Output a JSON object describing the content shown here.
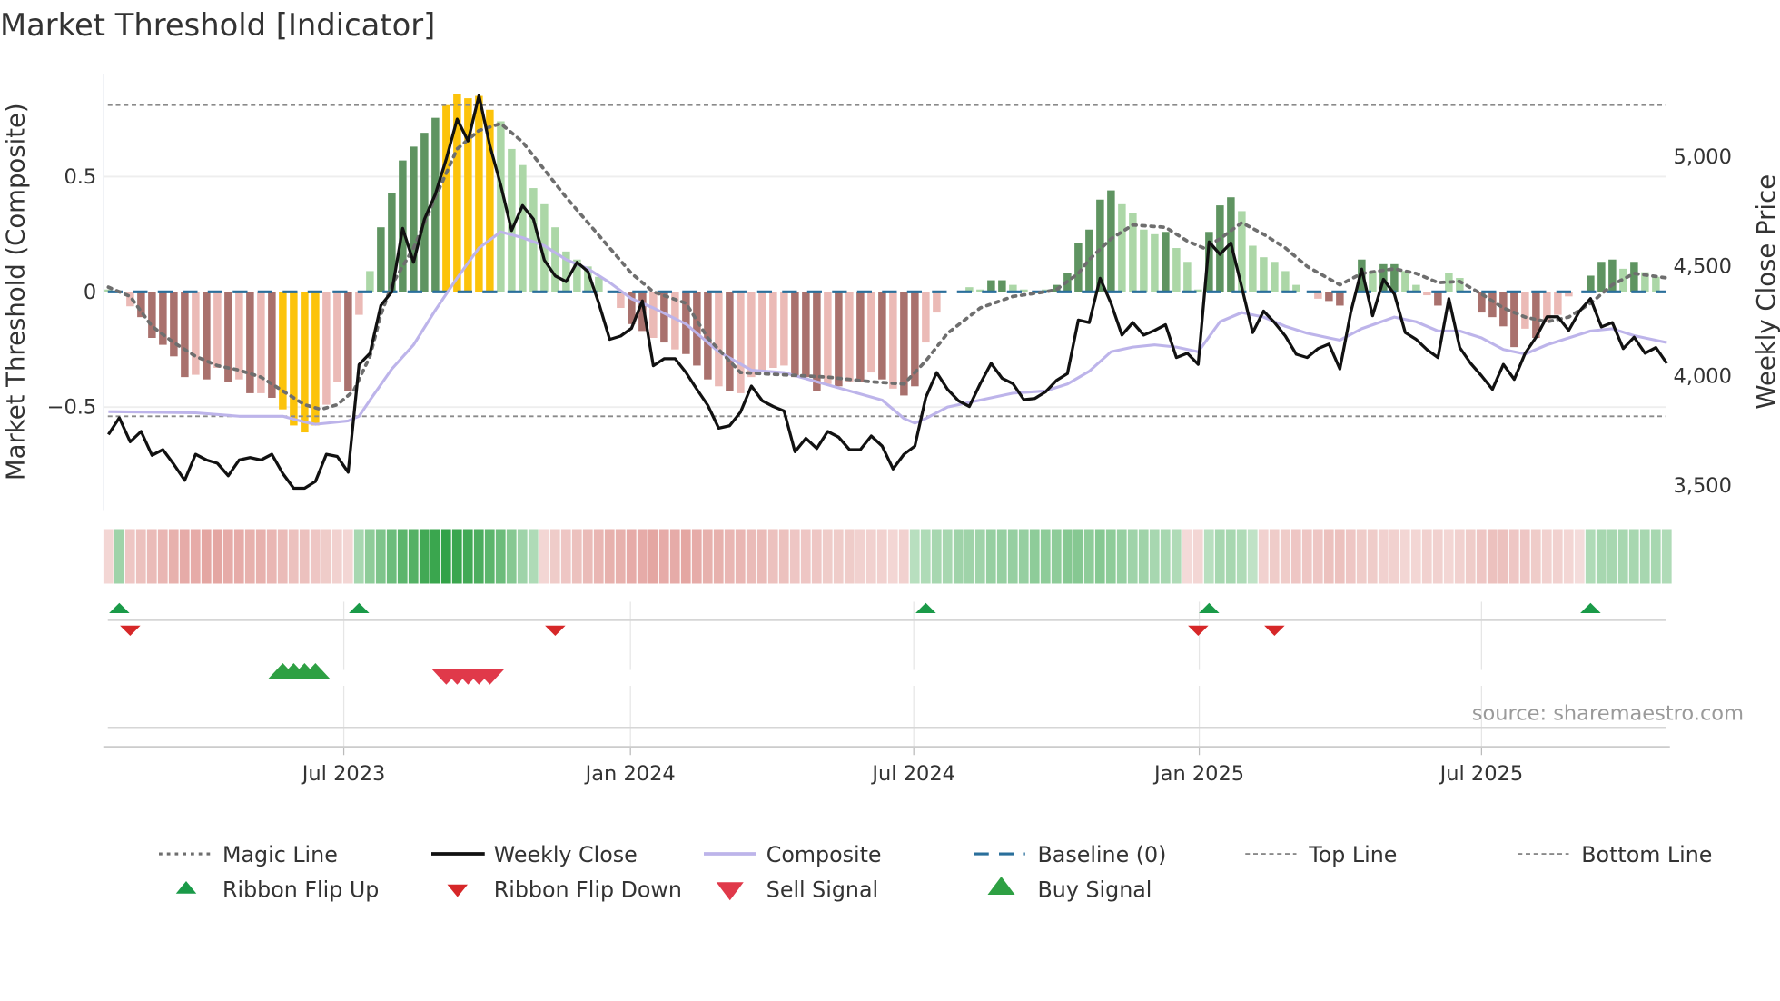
{
  "title": "Market Threshold [Indicator]",
  "source": "source: sharemaestro.com",
  "legend": {
    "magic_line": "Magic Line",
    "weekly_close": "Weekly Close",
    "composite": "Composite",
    "baseline": "Baseline (0)",
    "top_line": "Top Line",
    "bottom_line": "Bottom Line",
    "ribbon_flip_up": "Ribbon Flip Up",
    "ribbon_flip_down": "Ribbon Flip Down",
    "sell_signal": "Sell Signal",
    "buy_signal": "Buy Signal"
  },
  "colors": {
    "dark_red": "#a9716d",
    "light_red": "#ebbab6",
    "dark_green": "#5f9461",
    "light_green": "#acd7a7",
    "yellow": "#fcc30b",
    "close": "#111111",
    "composite": "#bdb4ea",
    "magic": "#6e6e6e",
    "baseline": "#2a6f9b",
    "levels": "#8a8a8a",
    "ribbon_green": "#2ea043",
    "ribbon_red": "#d67872",
    "buy": "#2ea043",
    "sell": "#e0394a",
    "flip_up": "#1a9a48",
    "flip_down": "#d62728"
  },
  "chart_data": {
    "type": "bar+line",
    "title": "Market Threshold [Indicator]",
    "ylabel_left": "Market Threshold (Composite)",
    "ylabel_right": "Weekly Close Price",
    "x_unit": "week index",
    "xlim": [
      0,
      143
    ],
    "ylim_left": [
      -0.95,
      0.93
    ],
    "ylim_right": [
      3450,
      5420
    ],
    "x_ticks": [
      {
        "week": 21.6,
        "label": "Jul 2023"
      },
      {
        "week": 47.9,
        "label": "Jan 2024"
      },
      {
        "week": 73.9,
        "label": "Jul 2024"
      },
      {
        "week": 100.1,
        "label": "Jan 2025"
      },
      {
        "week": 126.0,
        "label": "Jul 2025"
      }
    ],
    "left_ticks": [
      {
        "value": 0.5,
        "label": "0.5"
      },
      {
        "value": 0,
        "label": "0"
      },
      {
        "value": -0.5,
        "label": "−0.5"
      }
    ],
    "right_ticks": [
      {
        "value": 5000,
        "label": "5,000"
      },
      {
        "value": 4500,
        "label": "4,500"
      },
      {
        "value": 4000,
        "label": "4,000"
      },
      {
        "value": 3500,
        "label": "3,500"
      }
    ],
    "top_line": 0.81,
    "bottom_line": -0.54,
    "baseline": 0,
    "histogram": [
      0.01,
      0,
      -0.063,
      -0.11,
      -0.2,
      -0.23,
      -0.28,
      -0.37,
      -0.36,
      -0.38,
      -0.33,
      -0.39,
      -0.38,
      -0.44,
      -0.44,
      -0.46,
      -0.51,
      -0.58,
      -0.61,
      -0.58,
      -0.49,
      -0.39,
      -0.43,
      -0.1,
      0.09,
      0.28,
      0.43,
      0.57,
      0.63,
      0.69,
      0.755,
      0.81,
      0.86,
      0.84,
      0.85,
      0.79,
      0.74,
      0.62,
      0.55,
      0.45,
      0.38,
      0.28,
      0.175,
      0.14,
      0.11,
      0.065,
      0,
      -0.07,
      -0.14,
      -0.17,
      -0.2,
      -0.22,
      -0.25,
      -0.27,
      -0.32,
      -0.38,
      -0.41,
      -0.43,
      -0.44,
      -0.37,
      -0.35,
      -0.33,
      -0.32,
      -0.37,
      -0.37,
      -0.43,
      -0.4,
      -0.41,
      -0.39,
      -0.39,
      -0.35,
      -0.38,
      -0.42,
      -0.45,
      -0.41,
      -0.22,
      -0.09,
      0,
      0,
      0.02,
      0.01,
      0.05,
      0.05,
      0.03,
      0.01,
      0,
      0.01,
      0.03,
      0.08,
      0.21,
      0.27,
      0.4,
      0.44,
      0.38,
      0.34,
      0.27,
      0.25,
      0.26,
      0.19,
      0.13,
      0.01,
      0.26,
      0.375,
      0.41,
      0.35,
      0.2,
      0.15,
      0.13,
      0.09,
      0.03,
      0,
      -0.03,
      -0.04,
      -0.06,
      0,
      0.14,
      0.09,
      0.12,
      0.12,
      0.09,
      0.03,
      -0.015,
      -0.06,
      0.08,
      0.06,
      0,
      -0.09,
      -0.11,
      -0.15,
      -0.24,
      -0.16,
      -0.2,
      -0.13,
      -0.1,
      -0.02,
      0,
      0.07,
      0.13,
      0.14,
      0.1,
      0.13,
      0.085,
      0.065,
      0
    ],
    "histogram_style": [
      "LLLDDDDDLD",
      "LDLDLDYYYY",
      "LLDLLDDDDD",
      "DYYYYYLLLL",
      "LLLLLLLLDD",
      "LDLDDDLDLL",
      "LLLDDDLDLD",
      "LDLDDLLLLL",
      "LDDLLLLDDD",
      "DDDLLLLDLL",
      "LDDDLLLLLL",
      "LLDDLDLDDL",
      "LLDLLLDDDD",
      "LDLLLLDDDL",
      "DLLL"
    ],
    "weekly_close": [
      3727,
      3803,
      3694,
      3741,
      3632,
      3658,
      3591,
      3518,
      3637,
      3611,
      3596,
      3539,
      3611,
      3622,
      3611,
      3637,
      3549,
      3482,
      3482,
      3513,
      3637,
      3627,
      3555,
      4046,
      4098,
      4316,
      4378,
      4668,
      4513,
      4710,
      4824,
      4984,
      5166,
      5067,
      5274,
      5046,
      4865,
      4658,
      4772,
      4710,
      4523,
      4451,
      4425,
      4513,
      4471,
      4326,
      4161,
      4176,
      4212,
      4337,
      4041,
      4073,
      4073,
      4010,
      3933,
      3860,
      3756,
      3767,
      3829,
      3948,
      3881,
      3855,
      3834,
      3648,
      3710,
      3663,
      3741,
      3715,
      3658,
      3658,
      3720,
      3674,
      3570,
      3637,
      3674,
      3896,
      4010,
      3933,
      3881,
      3855,
      3959,
      4052,
      3984,
      3959,
      3886,
      3891,
      3922,
      3974,
      4005,
      4249,
      4238,
      4440,
      4326,
      4181,
      4238,
      4181,
      4202,
      4228,
      4078,
      4098,
      4047,
      4606,
      4549,
      4601,
      4399,
      4192,
      4290,
      4238,
      4176,
      4093,
      4078,
      4119,
      4140,
      4026,
      4285,
      4482,
      4269,
      4435,
      4368,
      4192,
      4161,
      4114,
      4078,
      4347,
      4124,
      4052,
      3995,
      3933,
      4047,
      3979,
      4098,
      4171,
      4264,
      4264,
      4202,
      4290,
      4347,
      4218,
      4238,
      4119,
      4171,
      4098,
      4124,
      4052
    ],
    "composite": [
      [
        0,
        -0.52
      ],
      [
        8,
        -0.525
      ],
      [
        12,
        -0.54
      ],
      [
        16,
        -0.54
      ],
      [
        18,
        -0.565
      ],
      [
        19,
        -0.575
      ],
      [
        22,
        -0.56
      ],
      [
        23,
        -0.54
      ],
      [
        24,
        -0.47
      ],
      [
        26,
        -0.335
      ],
      [
        28,
        -0.23
      ],
      [
        30,
        -0.08
      ],
      [
        32,
        0.06
      ],
      [
        34,
        0.19
      ],
      [
        36,
        0.26
      ],
      [
        38,
        0.235
      ],
      [
        40,
        0.2
      ],
      [
        42,
        0.14
      ],
      [
        44,
        0.1
      ],
      [
        46,
        0.04
      ],
      [
        48,
        -0.03
      ],
      [
        50,
        -0.07
      ],
      [
        53,
        -0.14
      ],
      [
        56,
        -0.26
      ],
      [
        59,
        -0.34
      ],
      [
        62,
        -0.35
      ],
      [
        65,
        -0.39
      ],
      [
        68,
        -0.43
      ],
      [
        71,
        -0.47
      ],
      [
        73,
        -0.55
      ],
      [
        74,
        -0.57
      ],
      [
        75,
        -0.55
      ],
      [
        77,
        -0.5
      ],
      [
        80,
        -0.47
      ],
      [
        83,
        -0.44
      ],
      [
        86,
        -0.43
      ],
      [
        88,
        -0.4
      ],
      [
        90,
        -0.345
      ],
      [
        92,
        -0.26
      ],
      [
        94,
        -0.24
      ],
      [
        96,
        -0.23
      ],
      [
        98,
        -0.24
      ],
      [
        100,
        -0.26
      ],
      [
        102,
        -0.13
      ],
      [
        104,
        -0.09
      ],
      [
        106,
        -0.11
      ],
      [
        108,
        -0.15
      ],
      [
        110,
        -0.18
      ],
      [
        112,
        -0.2
      ],
      [
        113,
        -0.21
      ],
      [
        115,
        -0.16
      ],
      [
        118,
        -0.11
      ],
      [
        120,
        -0.13
      ],
      [
        122,
        -0.17
      ],
      [
        124,
        -0.17
      ],
      [
        126,
        -0.2
      ],
      [
        128,
        -0.25
      ],
      [
        130,
        -0.27
      ],
      [
        132,
        -0.23
      ],
      [
        134,
        -0.2
      ],
      [
        136,
        -0.17
      ],
      [
        138,
        -0.16
      ],
      [
        140,
        -0.19
      ],
      [
        143,
        -0.22
      ]
    ],
    "magic_line": [
      [
        0,
        0.02
      ],
      [
        2,
        -0.02
      ],
      [
        4,
        -0.15
      ],
      [
        6,
        -0.22
      ],
      [
        8,
        -0.28
      ],
      [
        10,
        -0.32
      ],
      [
        12,
        -0.34
      ],
      [
        14,
        -0.37
      ],
      [
        16,
        -0.43
      ],
      [
        18,
        -0.49
      ],
      [
        19.5,
        -0.51
      ],
      [
        21,
        -0.49
      ],
      [
        22.5,
        -0.43
      ],
      [
        24,
        -0.28
      ],
      [
        25,
        -0.1
      ],
      [
        26,
        0.03
      ],
      [
        28,
        0.19
      ],
      [
        30,
        0.41
      ],
      [
        32,
        0.62
      ],
      [
        34,
        0.7
      ],
      [
        36,
        0.73
      ],
      [
        38,
        0.65
      ],
      [
        40,
        0.53
      ],
      [
        42,
        0.41
      ],
      [
        44,
        0.3
      ],
      [
        46,
        0.19
      ],
      [
        48,
        0.08
      ],
      [
        50,
        0
      ],
      [
        53,
        -0.05
      ],
      [
        55,
        -0.2
      ],
      [
        58,
        -0.35
      ],
      [
        62,
        -0.36
      ],
      [
        66,
        -0.37
      ],
      [
        70,
        -0.39
      ],
      [
        73,
        -0.4
      ],
      [
        75,
        -0.3
      ],
      [
        77,
        -0.18
      ],
      [
        80,
        -0.07
      ],
      [
        83,
        -0.02
      ],
      [
        86,
        0
      ],
      [
        87,
        0.01
      ],
      [
        89,
        0.08
      ],
      [
        90,
        0.14
      ],
      [
        92,
        0.23
      ],
      [
        94,
        0.29
      ],
      [
        97,
        0.28
      ],
      [
        99,
        0.22
      ],
      [
        100.5,
        0.19
      ],
      [
        102,
        0.23
      ],
      [
        104,
        0.3
      ],
      [
        106,
        0.25
      ],
      [
        108,
        0.19
      ],
      [
        110,
        0.11
      ],
      [
        113,
        0.03
      ],
      [
        115,
        0.08
      ],
      [
        118,
        0.1
      ],
      [
        120,
        0.08
      ],
      [
        122,
        0.04
      ],
      [
        124,
        0.045
      ],
      [
        126,
        -0.01
      ],
      [
        128,
        -0.07
      ],
      [
        130,
        -0.11
      ],
      [
        132,
        -0.13
      ],
      [
        134,
        -0.11
      ],
      [
        136,
        -0.05
      ],
      [
        138,
        0.03
      ],
      [
        140,
        0.08
      ],
      [
        143,
        0.06
      ]
    ],
    "ribbon_strength": [
      -0.15,
      0.35,
      -0.3,
      -0.35,
      -0.4,
      -0.45,
      -0.5,
      -0.55,
      -0.55,
      -0.6,
      -0.6,
      -0.55,
      -0.55,
      -0.5,
      -0.5,
      -0.45,
      -0.4,
      -0.35,
      -0.35,
      -0.3,
      -0.25,
      -0.2,
      -0.15,
      0.3,
      0.45,
      0.55,
      0.65,
      0.75,
      0.8,
      0.9,
      0.95,
      1,
      0.95,
      0.9,
      0.85,
      0.75,
      0.65,
      0.5,
      0.35,
      0.25,
      -0.15,
      -0.25,
      -0.3,
      -0.35,
      -0.4,
      -0.45,
      -0.5,
      -0.5,
      -0.55,
      -0.55,
      -0.6,
      -0.55,
      -0.55,
      -0.6,
      -0.55,
      -0.5,
      -0.5,
      -0.45,
      -0.45,
      -0.4,
      -0.4,
      -0.35,
      -0.35,
      -0.3,
      -0.3,
      -0.3,
      -0.25,
      -0.25,
      -0.25,
      -0.2,
      -0.2,
      -0.2,
      -0.15,
      -0.2,
      0.2,
      0.25,
      0.3,
      0.3,
      0.35,
      0.35,
      0.35,
      0.4,
      0.4,
      0.4,
      0.4,
      0.45,
      0.45,
      0.45,
      0.5,
      0.5,
      0.45,
      0.5,
      0.45,
      0.4,
      0.35,
      0.35,
      0.3,
      0.3,
      0.25,
      -0.12,
      -0.15,
      0.2,
      0.3,
      0.3,
      0.25,
      0.15,
      -0.2,
      -0.25,
      -0.25,
      -0.3,
      -0.3,
      -0.3,
      -0.35,
      -0.35,
      -0.3,
      -0.25,
      -0.25,
      -0.2,
      -0.2,
      -0.15,
      -0.15,
      -0.2,
      -0.2,
      -0.15,
      -0.2,
      -0.25,
      -0.3,
      -0.35,
      -0.35,
      -0.3,
      -0.3,
      -0.25,
      -0.2,
      -0.2,
      -0.15,
      -0.1,
      0.25,
      0.3,
      0.3,
      0.3,
      0.3,
      0.3,
      0.3,
      0.25
    ],
    "ribbon_flip_up_weeks": [
      1,
      23,
      75,
      101,
      136
    ],
    "ribbon_flip_down_weeks": [
      2,
      41,
      100,
      107
    ],
    "buy_signal_weeks": [
      16,
      17,
      18,
      19
    ],
    "sell_signal_weeks": [
      31,
      32,
      33,
      34,
      35
    ]
  }
}
